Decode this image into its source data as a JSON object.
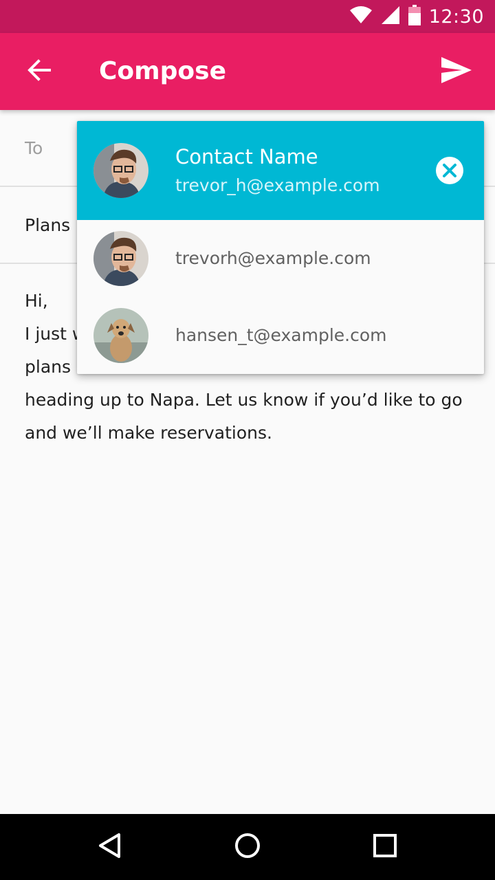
{
  "status_bar": {
    "time": "12:30",
    "icons": [
      "wifi-icon",
      "cellular-signal-icon",
      "battery-icon"
    ]
  },
  "app_bar": {
    "title": "Compose",
    "back_icon": "arrow-back-icon",
    "send_icon": "send-icon"
  },
  "compose": {
    "to_label": "To",
    "subject": "Plans",
    "body_lines": [
      "Hi,",
      "I just w",
      "plans",
      "heading up to Napa. Let us know if you’d like to go",
      "and we’ll make reservations."
    ]
  },
  "autocomplete": {
    "selected": {
      "name": "Contact Name",
      "email": "trevor_h@example.com",
      "clear_icon": "close-circle-icon"
    },
    "options": [
      {
        "email": "trevorh@example.com",
        "avatar": "man-with-glasses-avatar"
      },
      {
        "email": "hansen_t@example.com",
        "avatar": "dog-avatar"
      }
    ]
  },
  "nav_bar": {
    "icons": [
      "back-triangle-icon",
      "home-circle-icon",
      "recents-square-icon"
    ]
  },
  "colors": {
    "status_bar": "#c2185b",
    "app_bar": "#e91e63",
    "chip": "#00b8d4"
  }
}
